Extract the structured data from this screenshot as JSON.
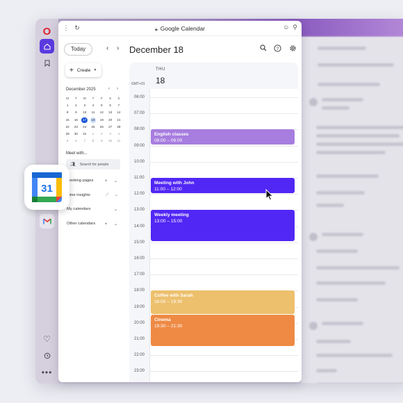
{
  "browser": {
    "address_title": "Google Calendar"
  },
  "calendar": {
    "today_label": "Today",
    "date_title": "December 18",
    "create_label": "Create",
    "mini_month": "December 2025",
    "weekday_heads": [
      "M",
      "T",
      "W",
      "T",
      "F",
      "S",
      "S"
    ],
    "mini_days": [
      [
        "1",
        "2",
        "3",
        "4",
        "5",
        "6",
        "7"
      ],
      [
        "8",
        "9",
        "10",
        "11",
        "12",
        "13",
        "14"
      ],
      [
        "15",
        "16",
        "17",
        "18",
        "19",
        "20",
        "21"
      ],
      [
        "22",
        "23",
        "24",
        "25",
        "26",
        "27",
        "28"
      ],
      [
        "29",
        "30",
        "31",
        "1",
        "2",
        "3",
        "4"
      ],
      [
        "5",
        "6",
        "7",
        "8",
        "9",
        "10",
        "11"
      ]
    ],
    "today_date": "17",
    "selected_date": "18",
    "meet_label": "Meet with...",
    "people_search_placeholder": "Search for people",
    "sections": {
      "booking": "Booking pages",
      "insights": "Time insights",
      "my_calendars": "My calendars",
      "other_calendars": "Other calendars"
    },
    "day_abbr": "THU",
    "day_number": "18",
    "timezone": "GMT+01",
    "hours": [
      "06:00",
      "07:00",
      "08:00",
      "09:00",
      "10:00",
      "11:00",
      "12:00",
      "13:00",
      "14:00",
      "15:00",
      "16:00",
      "17:00",
      "18:00",
      "19:00",
      "20:00",
      "21:00",
      "22:00",
      "23:00"
    ],
    "events": [
      {
        "title": "English classes",
        "time": "08:00 – 09:00",
        "color": "#a77ddf"
      },
      {
        "title": "Meeting with John",
        "time": "11:00 – 12:00",
        "color": "#5127f5"
      },
      {
        "title": "Weekly meeting",
        "time": "13:00 – 15:00",
        "color": "#5127f5"
      },
      {
        "title": "Coffee with Sarah",
        "time": "18:00 – 19:30",
        "color": "#edc06d"
      },
      {
        "title": "Cinema",
        "time": "19:30 – 21:30",
        "color": "#ee8a44"
      }
    ]
  },
  "gcal_icon": {
    "number": "31"
  }
}
